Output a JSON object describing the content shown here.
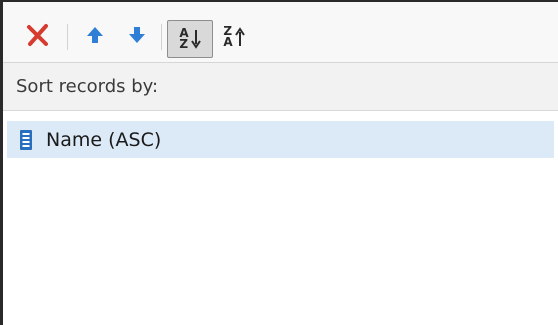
{
  "toolbar": {
    "buttons": [
      {
        "name": "delete",
        "icon": "delete-x-icon",
        "color": "#d63b2f"
      },
      {
        "name": "move-up",
        "icon": "arrow-up-icon",
        "color": "#2f7fd6"
      },
      {
        "name": "move-down",
        "icon": "arrow-down-icon",
        "color": "#2f7fd6"
      },
      {
        "name": "sort-ascending",
        "icon": "sort-az-icon",
        "pressed": true
      },
      {
        "name": "sort-descending",
        "icon": "sort-za-icon",
        "pressed": false
      }
    ],
    "sort_asc_glyph_top": "A",
    "sort_asc_glyph_bottom": "Z",
    "sort_desc_glyph_top": "Z",
    "sort_desc_glyph_bottom": "A"
  },
  "header": {
    "label": "Sort records by:"
  },
  "list": {
    "items": [
      {
        "label": "Name (ASC)",
        "icon": "field-icon",
        "selected": true
      }
    ]
  },
  "colors": {
    "selection": "#dce9f7",
    "delete_red": "#d63b2f",
    "arrow_blue": "#2f7fd6",
    "field_icon_blue": "#2a6fbf"
  }
}
